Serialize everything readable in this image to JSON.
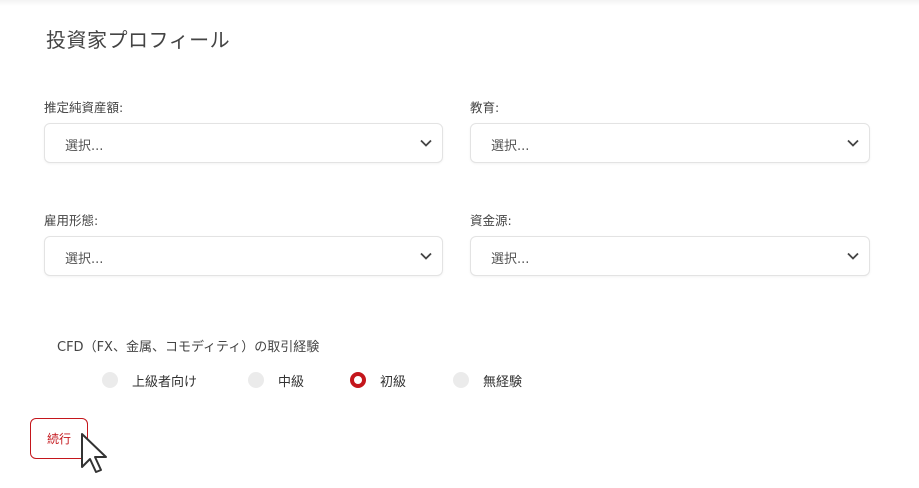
{
  "title": "投資家プロフィール",
  "fields": [
    {
      "label": "推定純資産額:",
      "value": "選択..."
    },
    {
      "label": "教育:",
      "value": "選択..."
    },
    {
      "label": "雇用形態:",
      "value": "選択..."
    },
    {
      "label": "資金源:",
      "value": "選択..."
    }
  ],
  "cfd": {
    "question": "CFD（FX、金属、コモディティ）の取引経験",
    "options": [
      "上級者向け",
      "中級",
      "初級",
      "無経験"
    ],
    "selected": "初級"
  },
  "continue_label": "続行",
  "colors": {
    "accent": "#c4161c"
  },
  "icons": {
    "select_chevron": "chevron-down-icon",
    "cursor": "mouse-pointer-icon"
  }
}
